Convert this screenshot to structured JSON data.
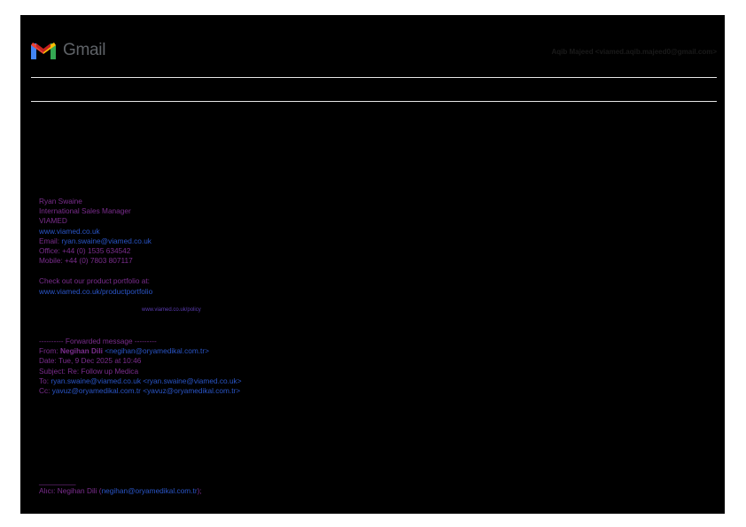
{
  "header": {
    "logo_text": "Gmail",
    "account": "Aqib Majeed <viamed.aqib.majeed0@gmail.com>"
  },
  "signature": {
    "name": "Ryan Swaine",
    "title": "International Sales Manager",
    "company": "VIAMED",
    "website": "www.viamed.co.uk",
    "email_label": "Email:",
    "email": "ryan.swaine@viamed.co.uk",
    "office": "Office: +44 (0) 1535 634542",
    "mobile": "Mobile: +44 (0) 7803 807117",
    "portfolio_text": "Check out our product portfolio at:",
    "portfolio_link": "www.viamed.co.uk/productportfolio",
    "policy_link": "www.viamed.co.uk/policy"
  },
  "forwarded": {
    "separator": "---------- Forwarded message ---------",
    "from_label": "From:",
    "from_name": "Negihan Dili",
    "from_email": "<negihan@oryamedikal.com.tr>",
    "date": "Date: Tue, 9 Dec 2025 at 10:46",
    "subject": "Subject: Re: Follow up Medica",
    "to_label": "To:",
    "to_email": "ryan.swaine@viamed.co.uk",
    "to_email_full": "<ryan.swaine@viamed.co.uk>",
    "cc_label": "Cc:",
    "cc_email": "yavuz@oryamedikal.com.tr",
    "cc_email_full": "<yavuz@oryamedikal.com.tr>"
  },
  "footer": {
    "separator": "_________",
    "from_prefix": "Alıcı: Negihan Dili (",
    "from_email": "negihan@oryamedikal.com.tr",
    "from_suffix": ");"
  },
  "colors": {
    "page": "#000000",
    "text_purple": "#7b2d8e",
    "link_blue": "#2a55c7"
  }
}
